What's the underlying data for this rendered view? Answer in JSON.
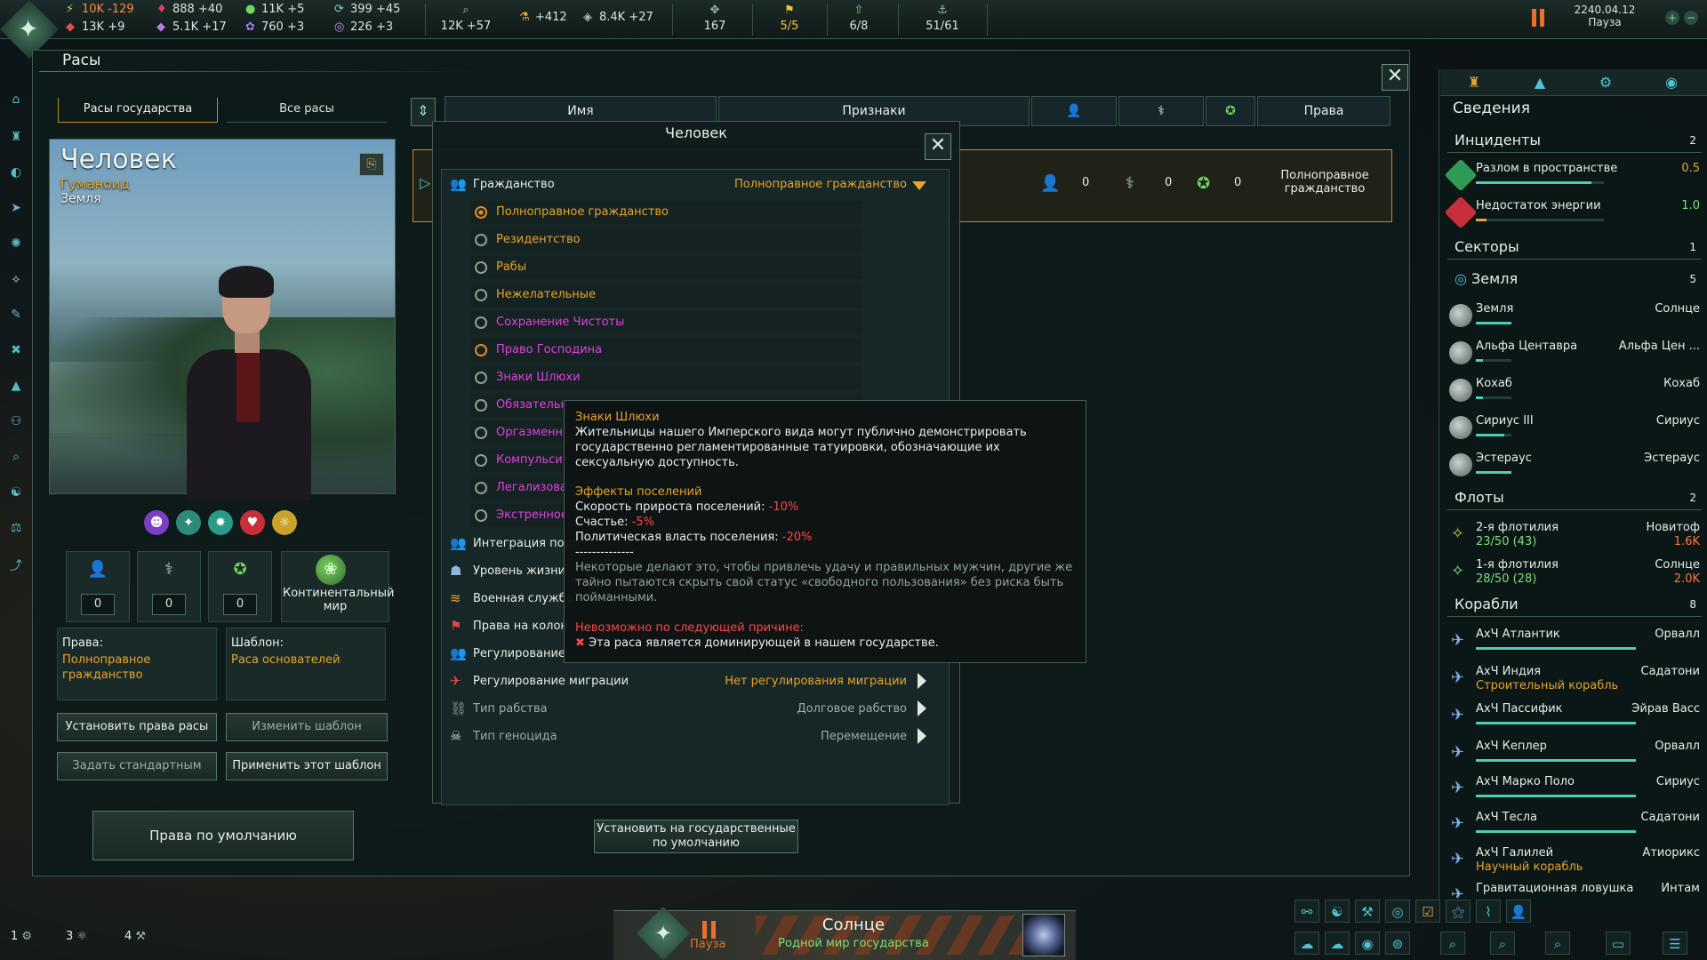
{
  "resources": {
    "energy": "10K -129",
    "minerals": "13K +9",
    "influence": "888 +40",
    "alloys": "5.1K +17",
    "food": "11K +5",
    "consumer_goods": "760 +3",
    "unity": "399 +45",
    "research_rare": "226 +3",
    "research": "12K +57",
    "research_boost": "+412",
    "trade": "8.4K +27",
    "fleet_capacity": "167",
    "starbases": "5/5",
    "envoys": "6/8",
    "naval": "51/61"
  },
  "top_right": {
    "date": "2240.04.12",
    "status": "Пауза"
  },
  "window": {
    "title": "Расы",
    "tabs": [
      "Расы государства",
      "Все расы"
    ]
  },
  "species": {
    "name": "Человек",
    "class": "Гуманоид",
    "homeworld": "Земля",
    "stats": [
      "0",
      "0",
      "0"
    ],
    "world_type": "Континентальный мир",
    "rights_label": "Права:",
    "rights_value": "Полноправное гражданство",
    "template_label": "Шаблон:",
    "template_value": "Раса основателей"
  },
  "buttons": {
    "set_rights": "Установить права расы",
    "change_template": "Изменить шаблон",
    "set_default": "Задать стандартным",
    "apply_template": "Применить этот шаблон",
    "default_rights": "Права по умолчанию",
    "set_state_defaults": "Установить на государственные по умолчанию"
  },
  "table": {
    "headers": [
      "Имя",
      "Признаки",
      "Права"
    ],
    "row": {
      "pops": "0",
      "dna": "0",
      "stars": "0",
      "rights": "Полноправное гражданство"
    }
  },
  "dialog": {
    "title": "Человек",
    "citizenship_label": "Гражданство",
    "citizenship_value": "Полноправное гражданство",
    "options": [
      "Полноправное гражданство",
      "Резидентство",
      "Рабы",
      "Нежелательные",
      "Сохранение Чистоты",
      "Право Господина",
      "Знаки Шлюхи",
      "Обязательн",
      "Оргазменн",
      "Компульси",
      "Легализова",
      "Экстренное"
    ],
    "policies": [
      {
        "name": "Интеграция подр",
        "value": ""
      },
      {
        "name": "Уровень жизни",
        "value": ""
      },
      {
        "name": "Военная служба",
        "value": ""
      },
      {
        "name": "Права на колон",
        "value": ""
      },
      {
        "name": "Регулирование",
        "value": ""
      },
      {
        "name": "Регулирование миграции",
        "value": "Нет регулирования миграции"
      },
      {
        "name": "Тип рабства",
        "value": "Долговое рабство"
      },
      {
        "name": "Тип геноцида",
        "value": "Перемещение"
      }
    ]
  },
  "tooltip": {
    "title": "Знаки Шлюхи",
    "description": "Жительницы нашего Имперского вида могут публично демонстрировать государственно регламентированные татуировки, обозначающие их сексуальную доступность.",
    "effects_title": "Эффекты поселений",
    "effect1_label": "Скорость прироста поселений:",
    "effect1_value": "-10%",
    "effect2_label": "Счастье:",
    "effect2_value": "-5%",
    "effect3_label": "Политическая власть поселения:",
    "effect3_value": "-20%",
    "separator": "--------------",
    "flavor": "Некоторые делают это, чтобы привлечь удачу и правильных мужчин, другие же тайно пытаются скрыть свой статус «свободного пользования» без риска быть пойманными.",
    "blocked_title": "Невозможно по следующей причине:",
    "blocked_reason": "Эта раса является доминирующей в нашем государстве."
  },
  "outliner": {
    "title": "Сведения",
    "incidents_label": "Инциденты",
    "incidents_count": "2",
    "incidents": [
      {
        "name": "Разлом в пространстве",
        "value": "0.5",
        "progress": 0.9
      },
      {
        "name": "Недостаток энергии",
        "value": "1.0",
        "progress": 0.08
      }
    ],
    "sectors_label": "Секторы",
    "sectors_count": "1",
    "sector_name": "Земля",
    "sector_count": "5",
    "planets": [
      {
        "name": "Земля",
        "system": "Солнце"
      },
      {
        "name": "Альфа Центавра",
        "system": "Альфа Цен ..."
      },
      {
        "name": "Кохаб",
        "system": "Кохаб"
      },
      {
        "name": "Сириус III",
        "system": "Сириус"
      },
      {
        "name": "Эстерауc",
        "system": "Эстерауc"
      }
    ],
    "fleets_label": "Флоты",
    "fleets_count": "2",
    "fleets": [
      {
        "name": "2-я флотилия",
        "strength": "23/50 (43)",
        "system": "Новитоф",
        "power": "1.6K"
      },
      {
        "name": "1-я флотилия",
        "strength": "28/50 (28)",
        "system": "Солнце",
        "power": "2.0K"
      }
    ],
    "ships_label": "Корабли",
    "ships_count": "8",
    "ships": [
      {
        "name": "АхЧ Атлантик",
        "sub": "",
        "system": "Орвалл"
      },
      {
        "name": "АхЧ Индия",
        "sub": "Строительный корабль",
        "system": "Садатони"
      },
      {
        "name": "АхЧ Пассифик",
        "sub": "",
        "system": "Эйрав Васс"
      },
      {
        "name": "АхЧ Кеплер",
        "sub": "",
        "system": "Орвалл"
      },
      {
        "name": "АхЧ Марко Поло",
        "sub": "",
        "system": "Сириус"
      },
      {
        "name": "АхЧ Тесла",
        "sub": "",
        "system": "Садатони"
      },
      {
        "name": "АхЧ Галилей",
        "sub": "Научный корабль",
        "system": "Атиорикс"
      },
      {
        "name": "Гравитационная ловушка",
        "sub": "",
        "system": "Интам"
      }
    ]
  },
  "bottom": {
    "pause": "Пауза",
    "system": "Солнце",
    "subtitle": "Родной мир государства",
    "queue": [
      "1",
      "3",
      "4"
    ]
  }
}
